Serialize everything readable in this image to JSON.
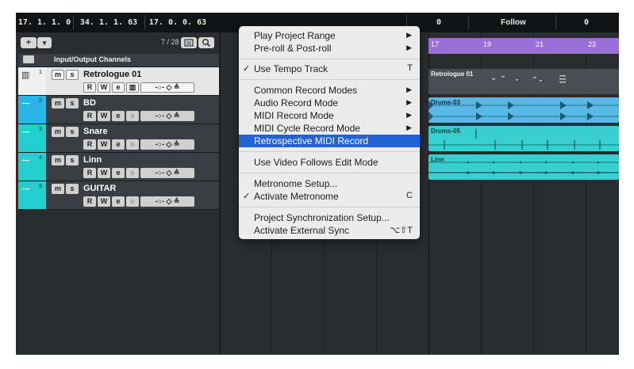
{
  "transport": {
    "left_pos": "17. 1. 1.   0",
    "right_pos": "34. 1. 1.  63",
    "length": "17. 0. 0.  63",
    "punch_value": "0",
    "follow_label": "Follow",
    "end_value": "0"
  },
  "toolbar": {
    "add_label": "+",
    "dropdown_label": "▾",
    "counter": "7 / 28"
  },
  "folder": {
    "name": "Input/Output Channels"
  },
  "tracks": [
    {
      "num": "1",
      "name": "Retrologue 01",
      "color": "#f0f0f0"
    },
    {
      "num": "2",
      "name": "BD",
      "color": "#2ab5e8"
    },
    {
      "num": "3",
      "name": "Snare",
      "color": "#1fd0cf"
    },
    {
      "num": "4",
      "name": "Linn",
      "color": "#1fd0cf"
    },
    {
      "num": "5",
      "name": "GUITAR",
      "color": "#1fd0cf"
    }
  ],
  "track_buttons": {
    "m": "m",
    "s": "s",
    "r": "R",
    "w": "W"
  },
  "ruler": {
    "marks": [
      "17",
      "19",
      "21",
      "23"
    ]
  },
  "parts": [
    {
      "name": "Retrologue 01",
      "color": "#4a4e52"
    },
    {
      "name": "Drums-03",
      "color": "#58b9e4"
    },
    {
      "name": "Drums-05",
      "color": "#37cfd0"
    },
    {
      "name": "Linn",
      "color": "#37cfd0"
    }
  ],
  "menu": {
    "items": [
      {
        "label": "Play Project Range",
        "submenu": "▶"
      },
      {
        "label": "Pre-roll & Post-roll",
        "submenu": "▶"
      },
      {
        "label": "Use Tempo Track",
        "check": "✓",
        "shortcut": "T"
      },
      {
        "label": "Common Record Modes",
        "submenu": "▶"
      },
      {
        "label": "Audio Record Mode",
        "submenu": "▶"
      },
      {
        "label": "MIDI Record Mode",
        "submenu": "▶"
      },
      {
        "label": "MIDI Cycle Record Mode",
        "submenu": "▶"
      },
      {
        "label": "Retrospective MIDI Record"
      },
      {
        "label": "Use Video Follows Edit Mode"
      },
      {
        "label": "Metronome Setup..."
      },
      {
        "label": "Activate Metronome",
        "check": "✓",
        "shortcut": "C"
      },
      {
        "label": "Project Synchronization Setup..."
      },
      {
        "label": "Activate External Sync",
        "shortcut": "⌥⇧T"
      }
    ]
  },
  "colors": {
    "menu_highlight": "#1f64d6",
    "ruler": "#9b6fd8"
  }
}
